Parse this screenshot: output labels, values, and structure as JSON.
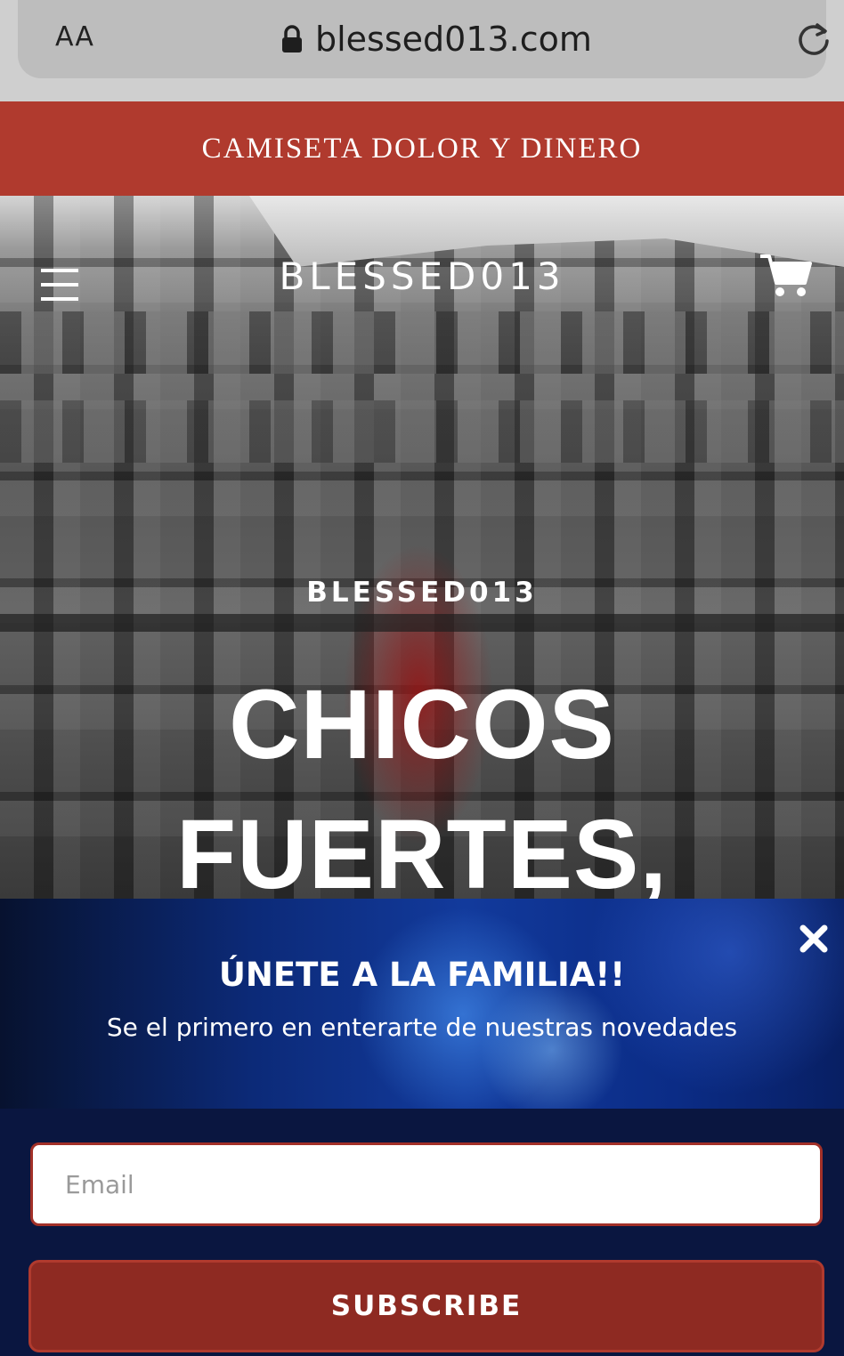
{
  "browser": {
    "text_size_label": "AA",
    "url": "blessed013.com",
    "lock_icon": "lock-icon",
    "reload_icon": "reload-icon"
  },
  "announcement": {
    "text": "CAMISETA DOLOR Y DINERO",
    "background": "#b03a2e"
  },
  "header": {
    "brand": "BLESSED013",
    "menu_icon": "hamburger-menu-icon",
    "cart_icon": "cart-icon"
  },
  "hero": {
    "subtitle": "BLESSED013",
    "title_line1": "CHICOS",
    "title_line2": "FUERTES,"
  },
  "popup": {
    "title": "ÚNETE A LA FAMILIA!!",
    "text": "Se el primero en enterarte de nuestras novedades",
    "email_placeholder": "Email",
    "subscribe_label": "SUBSCRIBE",
    "close_icon": "close-icon",
    "accent": "#8e2a22",
    "background": "#0a1640"
  }
}
